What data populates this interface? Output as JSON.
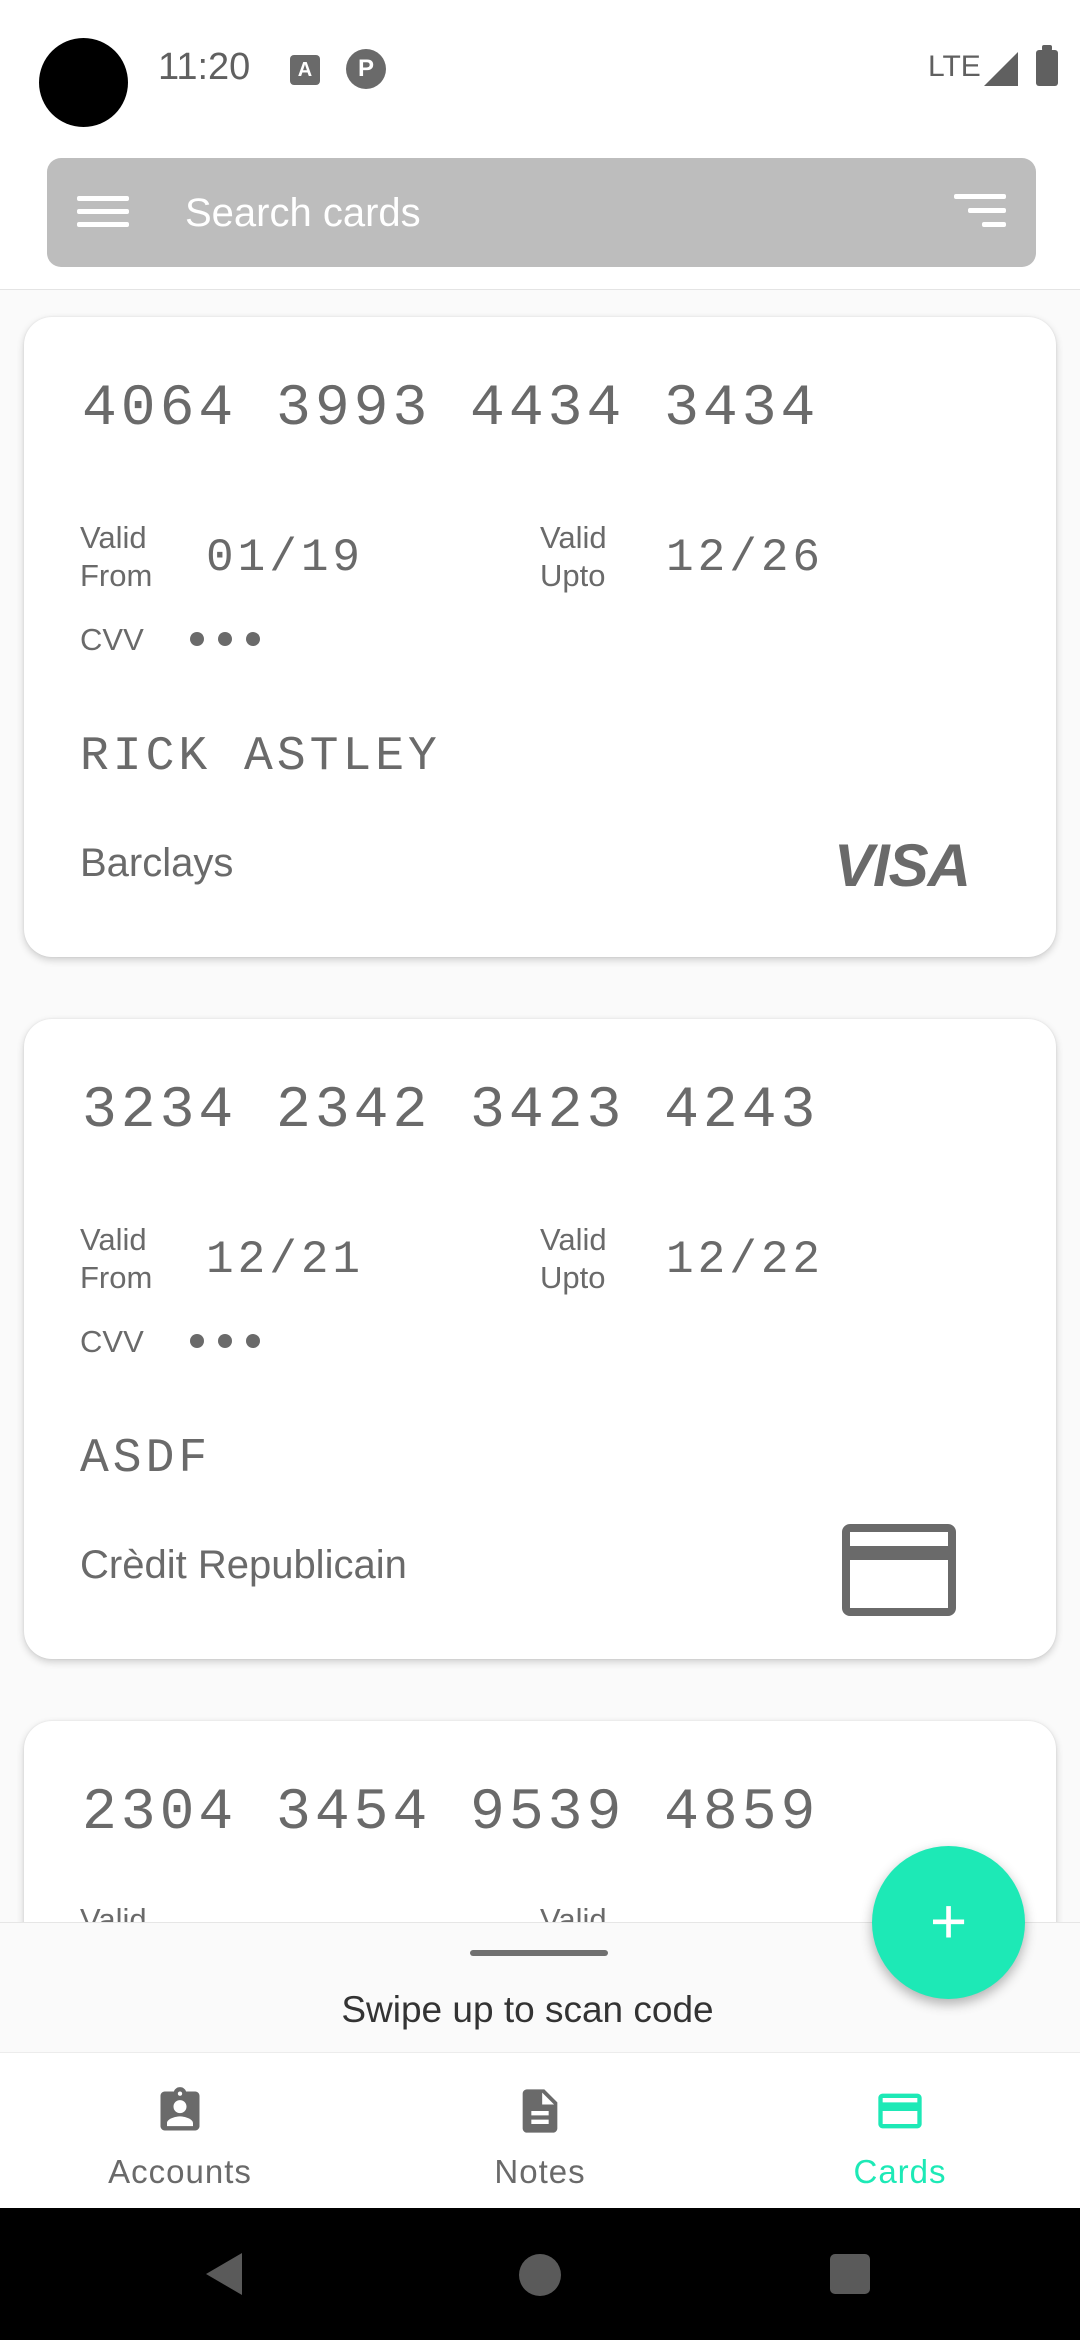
{
  "status_bar": {
    "time": "11:20",
    "network": "LTE",
    "icon_a": "A",
    "icon_p": "P"
  },
  "search": {
    "placeholder": "Search cards"
  },
  "labels": {
    "valid_from_1": "Valid",
    "valid_from_2": "From",
    "valid_upto_1": "Valid",
    "valid_upto_2": "Upto",
    "cvv": "CVV"
  },
  "cards": [
    {
      "number": "4064 3993 4434 3434",
      "valid_from": "01/19",
      "valid_upto": "12/26",
      "holder": "RICK ASTLEY",
      "bank": "Barclays",
      "network_logo": "VISA"
    },
    {
      "number": "3234 2342 3423 4243",
      "valid_from": "12/21",
      "valid_upto": "12/22",
      "holder": "ASDF",
      "bank": "Crèdit Republicain",
      "network_logo": "credit-card-icon"
    },
    {
      "number": "2304 3454 9539 4859"
    }
  ],
  "scan": {
    "text": "Swipe up to scan code"
  },
  "fab": {
    "icon": "+"
  },
  "bottom_nav": [
    {
      "label": "Accounts",
      "icon": "account-badge-icon",
      "active": false
    },
    {
      "label": "Notes",
      "icon": "note-icon",
      "active": false
    },
    {
      "label": "Cards",
      "icon": "credit-card-icon",
      "active": true
    }
  ],
  "colors": {
    "accent": "#1de9b6",
    "search_bar": "#bdbdbd",
    "text": "#6a6a6a"
  }
}
